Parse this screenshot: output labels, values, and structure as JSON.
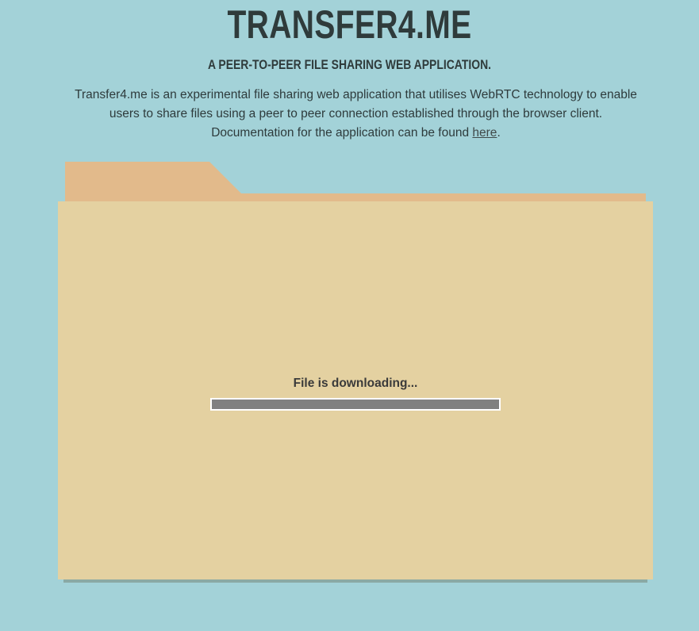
{
  "header": {
    "title": "TRANSFER4.ME",
    "subtitle": "A PEER-TO-PEER FILE SHARING WEB APPLICATION.",
    "description_line": "Transfer4.me is an experimental file sharing web application that utilises WebRTC technology to enable users to share files using a peer to peer connection established through the browser client.",
    "documentation_prefix": "Documentation for the application can be found",
    "documentation_link": "here",
    "documentation_suffix": "."
  },
  "transfer": {
    "status": "File is downloading...",
    "progress": 1.0
  },
  "colors": {
    "background": "#a3d2d8",
    "folder_front": "#e4d1a1",
    "folder_tab": "#e2ba8b",
    "text": "#2f3b3b",
    "progress_fill": "#808080"
  }
}
